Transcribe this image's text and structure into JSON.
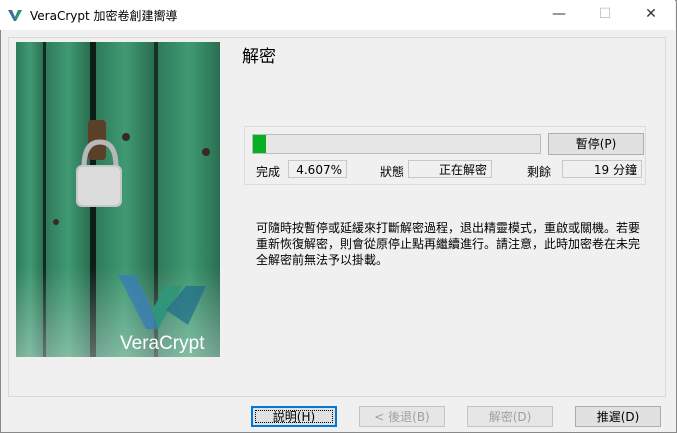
{
  "window": {
    "title": "VeraCrypt 加密卷創建嚮導",
    "icon": "veracrypt-logo-icon",
    "controls": {
      "minimize": "—",
      "maximize": "☐",
      "close": "✕"
    }
  },
  "side_panel": {
    "brand": "VeraCrypt",
    "image": "padlock-on-green-door"
  },
  "page": {
    "title": "解密"
  },
  "progress": {
    "percent": 4.607,
    "pause_label": "暫停(P)",
    "done_label": "完成",
    "done_value": "4.607%",
    "status_label": "狀態",
    "status_value": "正在解密",
    "remaining_label": "剩餘",
    "remaining_value": "19 分鐘"
  },
  "info": {
    "text": "可隨時按暫停或延緩來打斷解密過程，退出精靈模式，重啟或關機。若要重新恢復解密，則會從原停止點再繼續進行。請注意，此時加密卷在未完全解密前無法予以掛載。"
  },
  "buttons": {
    "help": "説明(H)",
    "back": "< 後退(B)",
    "decrypt": "解密(D)",
    "defer": "推遲(D)"
  },
  "colors": {
    "progress_fill": "#06b025",
    "focus_border": "#0078d7"
  }
}
